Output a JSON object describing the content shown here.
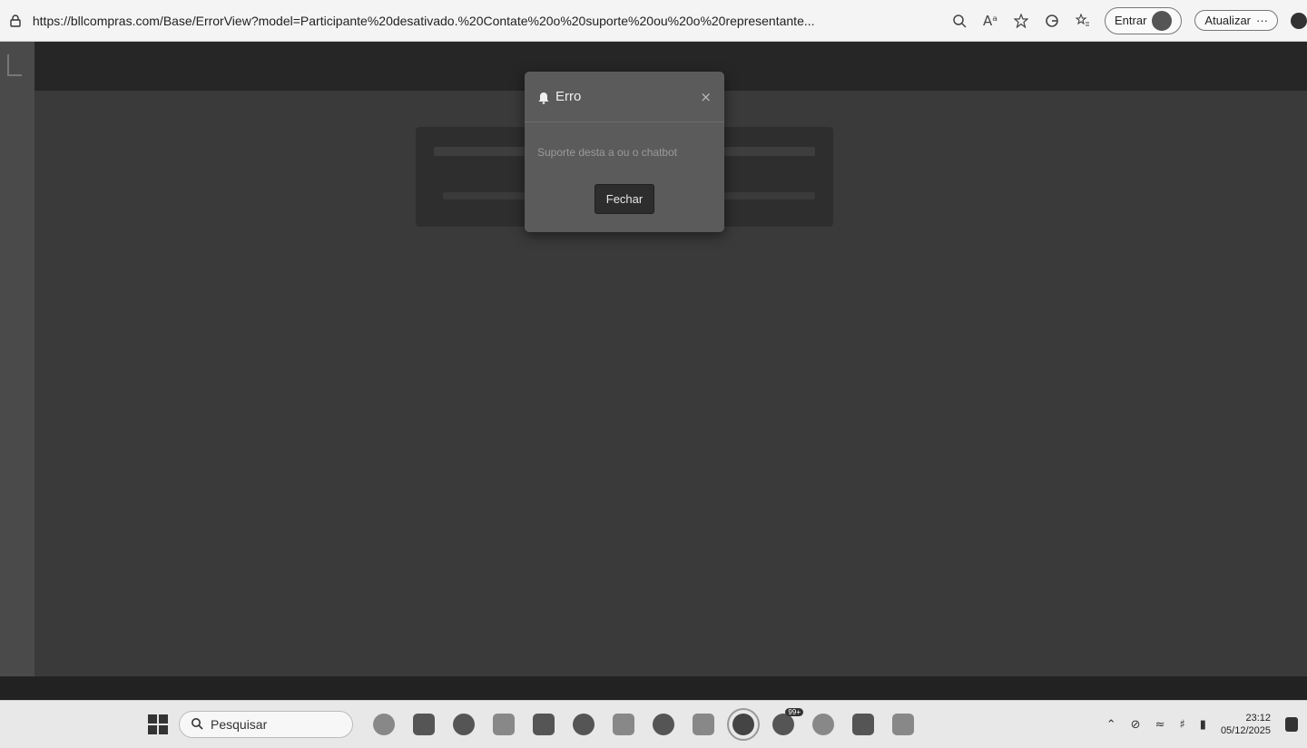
{
  "browser": {
    "url": "https://bllcompras.com/Base/ErrorView?model=Participante%20desativado.%20Contate%20o%20suporte%20ou%20o%20representante...",
    "zoom_icon": "zoom-icon",
    "read_aloud_icon": "Aᵃ",
    "signin_label": "Entrar",
    "update_label": "Atualizar",
    "more_label": "···"
  },
  "modal": {
    "title": "Erro",
    "close_symbol": "×",
    "message": "Suporte desta a ou o chatbot",
    "button_label": "Fechar"
  },
  "taskbar": {
    "search_placeholder": "Pesquisar",
    "badge": "99+",
    "time": "23:12",
    "date": "05/12/2025"
  }
}
